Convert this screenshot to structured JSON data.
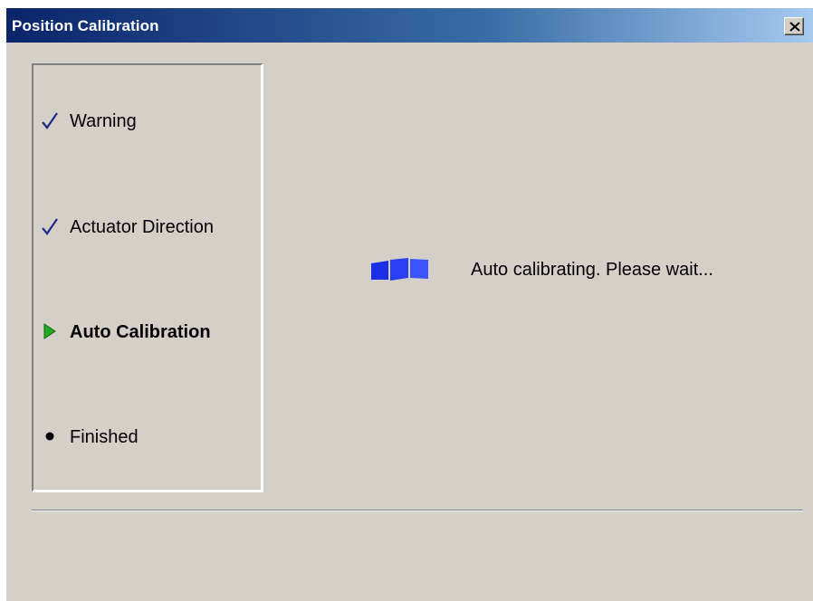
{
  "window": {
    "title": "Position Calibration",
    "close_icon": "close-icon"
  },
  "steps": [
    {
      "label": "Warning",
      "state": "done",
      "icon": "checkmark-icon"
    },
    {
      "label": "Actuator Direction",
      "state": "done",
      "icon": "checkmark-icon"
    },
    {
      "label": "Auto Calibration",
      "state": "active",
      "icon": "arrow-right-icon"
    },
    {
      "label": "Finished",
      "state": "pending",
      "icon": "bullet-icon"
    }
  ],
  "status": {
    "message": "Auto calibrating. Please wait...",
    "icon": "progress-icon"
  },
  "colors": {
    "window_bg": "#d4d0c8",
    "titlebar_start": "#0a246a",
    "titlebar_end": "#a6caf0",
    "check": "#1c2a8c",
    "active_arrow": "#22aa22",
    "progress": "#1a2ee6"
  }
}
